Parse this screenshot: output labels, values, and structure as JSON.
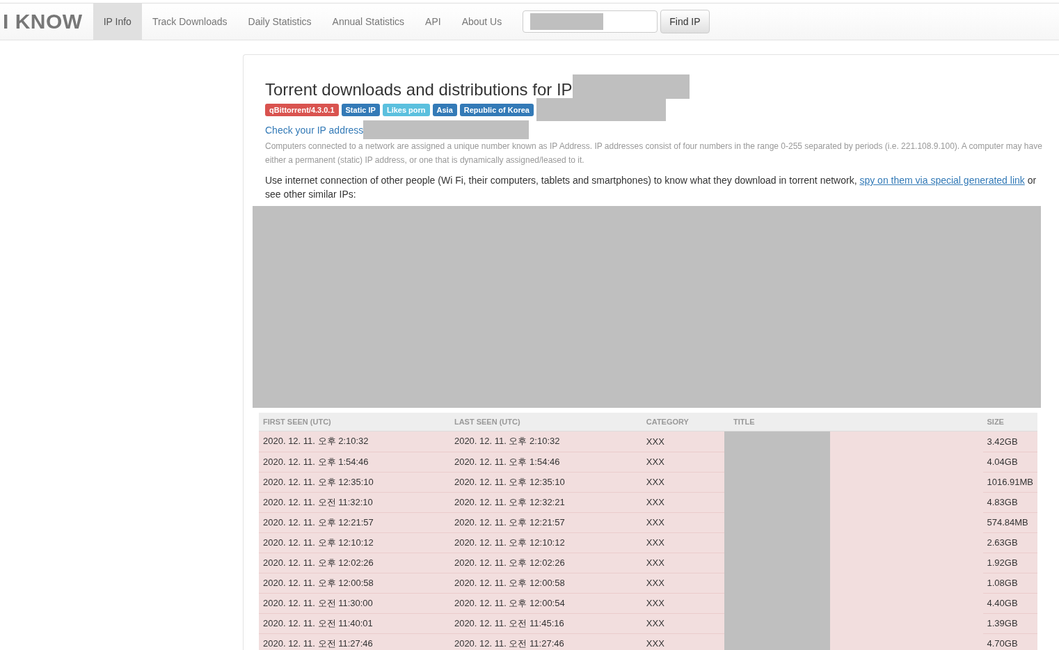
{
  "navbar": {
    "brand": "I KNOW",
    "items": [
      {
        "label": "IP Info",
        "selected": true
      },
      {
        "label": "Track Downloads",
        "selected": false
      },
      {
        "label": "Daily Statistics",
        "selected": false
      },
      {
        "label": "Annual Statistics",
        "selected": false
      },
      {
        "label": "API",
        "selected": false
      },
      {
        "label": "About Us",
        "selected": false
      }
    ],
    "search_button": "Find IP"
  },
  "heading": "Torrent downloads and distributions for IP",
  "badges": [
    {
      "label": "qBittorrent/4.3.0.1",
      "color": "#d9534f"
    },
    {
      "label": "Static IP",
      "color": "#337ab7"
    },
    {
      "label": "Likes porn",
      "color": "#5bc0de"
    },
    {
      "label": "Asia",
      "color": "#337ab7"
    },
    {
      "label": "Republic of Korea",
      "color": "#337ab7"
    }
  ],
  "check_link": "Check your IP address",
  "explanation": "Computers connected to a network are assigned a unique number known as IP Address. IP addresses consist of four numbers in the range 0-255 separated by periods (i.e. 221.108.9.100). A computer may have either a permanent (static) IP address, or one that is dynamically assigned/leased to it.",
  "intro": {
    "before": "Use internet connection of other people (Wi Fi, their computers, tablets and smartphones) to know what they download in torrent network,",
    "link": "spy on them via special generated link",
    "after": "or see other similar IPs:"
  },
  "table": {
    "columns": [
      "FIRST SEEN (UTC)",
      "LAST SEEN (UTC)",
      "CATEGORY",
      "TITLE",
      "SIZE"
    ],
    "rows": [
      [
        "2020. 12. 11. 오후 2:10:32",
        "2020. 12. 11. 오후 2:10:32",
        "XXX",
        "3.42GB"
      ],
      [
        "2020. 12. 11. 오후 1:54:46",
        "2020. 12. 11. 오후 1:54:46",
        "XXX",
        "4.04GB"
      ],
      [
        "2020. 12. 11. 오후 12:35:10",
        "2020. 12. 11. 오후 12:35:10",
        "XXX",
        "1016.91MB"
      ],
      [
        "2020. 12. 11. 오전 11:32:10",
        "2020. 12. 11. 오후 12:32:21",
        "XXX",
        "4.83GB"
      ],
      [
        "2020. 12. 11. 오후 12:21:57",
        "2020. 12. 11. 오후 12:21:57",
        "XXX",
        "574.84MB"
      ],
      [
        "2020. 12. 11. 오후 12:10:12",
        "2020. 12. 11. 오후 12:10:12",
        "XXX",
        "2.63GB"
      ],
      [
        "2020. 12. 11. 오후 12:02:26",
        "2020. 12. 11. 오후 12:02:26",
        "XXX",
        "1.92GB"
      ],
      [
        "2020. 12. 11. 오후 12:00:58",
        "2020. 12. 11. 오후 12:00:58",
        "XXX",
        "1.08GB"
      ],
      [
        "2020. 12. 11. 오전 11:30:00",
        "2020. 12. 11. 오후 12:00:54",
        "XXX",
        "4.40GB"
      ],
      [
        "2020. 12. 11. 오전 11:40:01",
        "2020. 12. 11. 오전 11:45:16",
        "XXX",
        "1.39GB"
      ],
      [
        "2020. 12. 11. 오전 11:27:46",
        "2020. 12. 11. 오전 11:27:46",
        "XXX",
        "4.70GB"
      ]
    ]
  }
}
